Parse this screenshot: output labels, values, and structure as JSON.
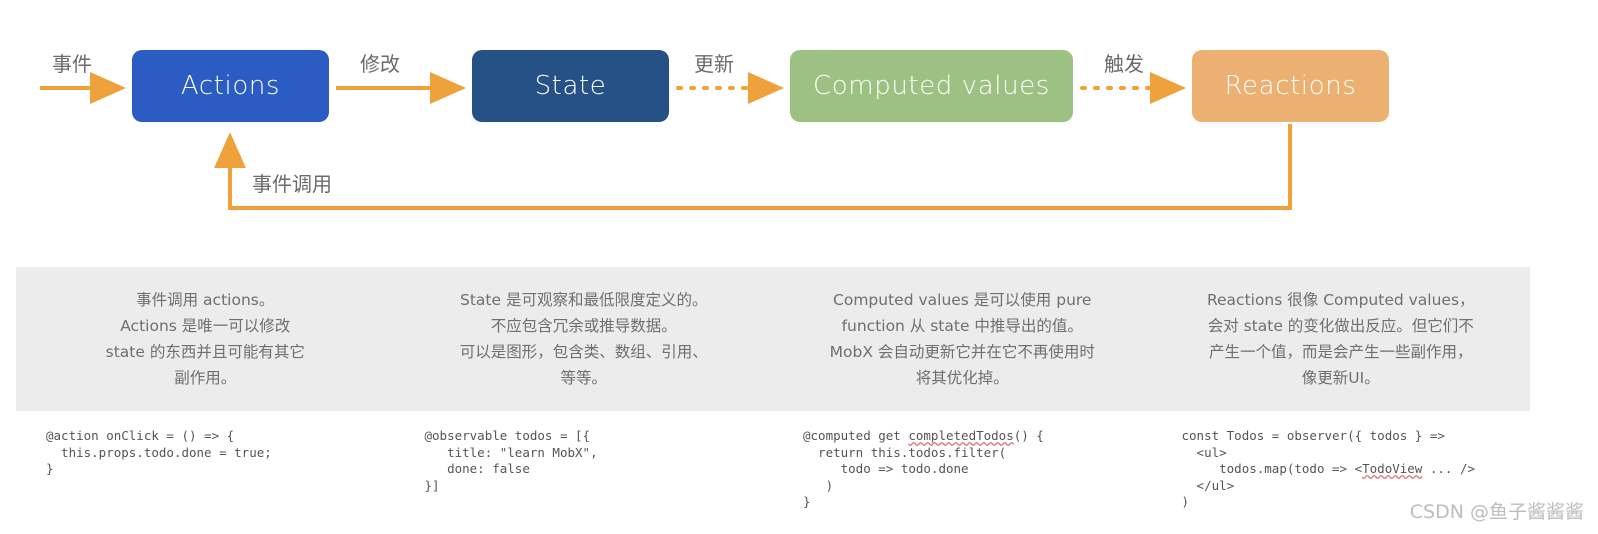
{
  "colors": {
    "actions": "#2B5CC4",
    "state": "#255187",
    "computed": "#9CC183",
    "reactions": "#ECB172",
    "arrow": "#EFA23C",
    "band_bg": "#ececec",
    "text_gray": "#6f6f6f",
    "code_gray": "#555555",
    "watermark": "#bdbdbd"
  },
  "diagram": {
    "nodes": [
      {
        "id": "actions",
        "label": "Actions"
      },
      {
        "id": "state",
        "label": "State"
      },
      {
        "id": "computed",
        "label": "Computed values"
      },
      {
        "id": "reactions",
        "label": "Reactions"
      }
    ],
    "edges": [
      {
        "id": "event",
        "label": "事件",
        "style": "solid",
        "from": "start",
        "to": "actions"
      },
      {
        "id": "modify",
        "label": "修改",
        "style": "solid",
        "from": "actions",
        "to": "state"
      },
      {
        "id": "update",
        "label": "更新",
        "style": "dotted",
        "from": "state",
        "to": "computed"
      },
      {
        "id": "trigger",
        "label": "触发",
        "style": "dotted",
        "from": "computed",
        "to": "reactions"
      },
      {
        "id": "callback",
        "label": "事件调用",
        "style": "solid",
        "from": "reactions",
        "to": "actions"
      }
    ]
  },
  "descriptions": [
    {
      "id": "actions",
      "lines": [
        "事件调用 actions。",
        "Actions 是唯一可以修改",
        "state 的东西并且可能有其它",
        "副作用。"
      ]
    },
    {
      "id": "state",
      "lines": [
        "State 是可观察和最低限度定义的。",
        "不应包含冗余或推导数据。",
        "可以是图形，包含类、数组、引用、",
        "等等。"
      ]
    },
    {
      "id": "computed",
      "lines": [
        "Computed values 是可以使用 pure",
        "function 从 state 中推导出的值。",
        "MobX 会自动更新它并在它不再使用时",
        "将其优化掉。"
      ]
    },
    {
      "id": "reactions",
      "lines": [
        "Reactions 很像 Computed values，",
        "会对 state 的变化做出反应。但它们不",
        "产生一个值，而是会产生一些副作用，",
        "像更新UI。"
      ]
    }
  ],
  "code_samples": [
    {
      "id": "actions",
      "code": "@action onClick = () => {\n  this.props.todo.done = true;\n}"
    },
    {
      "id": "state",
      "code": "@observable todos = [{\n   title: \"learn MobX\",\n   done: false\n}]"
    },
    {
      "id": "computed",
      "pre": "@computed get ",
      "misspelled": "completedTodos",
      "post": "() {\n  return this.todos.filter(\n     todo => todo.done\n   )\n}"
    },
    {
      "id": "reactions",
      "pre": "const Todos = observer({ todos } =>\n  <ul>\n     todos.map(todo => <",
      "misspelled": "TodoView",
      "post": " ... />\n  </ul>\n)"
    }
  ],
  "watermark": "CSDN @鱼子酱酱酱"
}
